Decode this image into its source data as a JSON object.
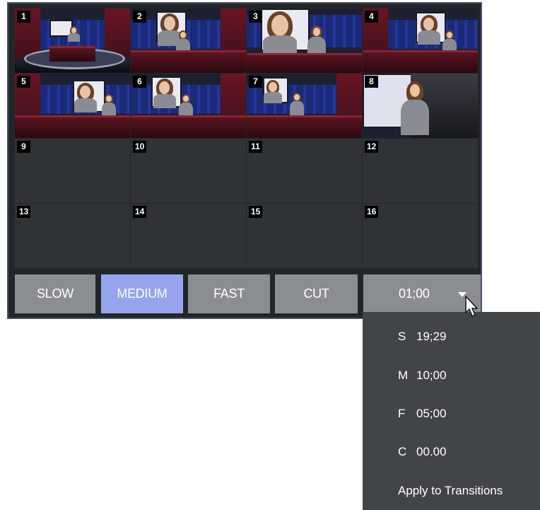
{
  "cells": [
    {
      "number": "1",
      "variant": "wide"
    },
    {
      "number": "2",
      "variant": "pair"
    },
    {
      "number": "3",
      "variant": "close"
    },
    {
      "number": "4",
      "variant": "pair-right"
    },
    {
      "number": "5",
      "variant": "pair-right"
    },
    {
      "number": "6",
      "variant": "pair"
    },
    {
      "number": "7",
      "variant": "pair"
    },
    {
      "number": "8",
      "variant": "single"
    },
    {
      "number": "9",
      "variant": "empty"
    },
    {
      "number": "10",
      "variant": "empty"
    },
    {
      "number": "11",
      "variant": "empty"
    },
    {
      "number": "12",
      "variant": "empty"
    },
    {
      "number": "13",
      "variant": "empty"
    },
    {
      "number": "14",
      "variant": "empty"
    },
    {
      "number": "15",
      "variant": "empty"
    },
    {
      "number": "16",
      "variant": "empty"
    }
  ],
  "speed_buttons": {
    "slow": "SLOW",
    "medium": "MEDIUM",
    "fast": "FAST",
    "cut": "CUT",
    "selected": "MEDIUM"
  },
  "duration": {
    "value": "01;00",
    "caret_icon": "chevron-down-icon"
  },
  "dropdown": {
    "items": [
      {
        "key": "S",
        "value": "19;29"
      },
      {
        "key": "M",
        "value": "10;00"
      },
      {
        "key": "F",
        "value": "05;00"
      },
      {
        "key": "C",
        "value": "00.00"
      }
    ],
    "apply_label": "Apply to Transitions"
  },
  "colors": {
    "button": "#8a8e93",
    "button_active": "#95a4ec",
    "panel_border": "#4a5066",
    "dropdown_bg": "#424548"
  }
}
